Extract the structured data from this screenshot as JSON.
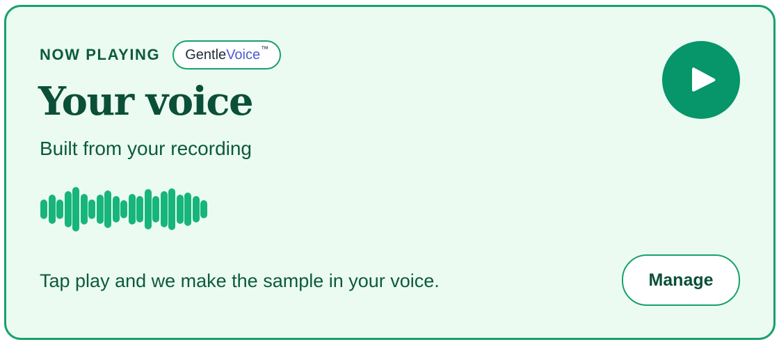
{
  "card": {
    "eyebrow": "NOW PLAYING",
    "brand": {
      "part_a": "Gentle",
      "part_b": "Voice",
      "trademark": "™"
    },
    "title": "Your voice",
    "subtitle": "Built from your recording",
    "hint": "Tap play and we make the sample in your voice.",
    "play_icon": "play-icon",
    "manage_label": "Manage"
  },
  "colors": {
    "background": "#ebfbf2",
    "border": "#18a06e",
    "accent": "#079669",
    "waveform": "#17b57b",
    "text_dark": "#0b4f38",
    "brand_highlight": "#4a5bd4"
  },
  "waveform": {
    "levels": [
      0.45,
      0.65,
      0.45,
      0.8,
      1.0,
      0.7,
      0.45,
      0.65,
      0.85,
      0.6,
      0.4,
      0.7,
      0.6,
      0.9,
      0.6,
      0.8,
      0.95,
      0.65,
      0.75,
      0.6,
      0.4
    ]
  }
}
